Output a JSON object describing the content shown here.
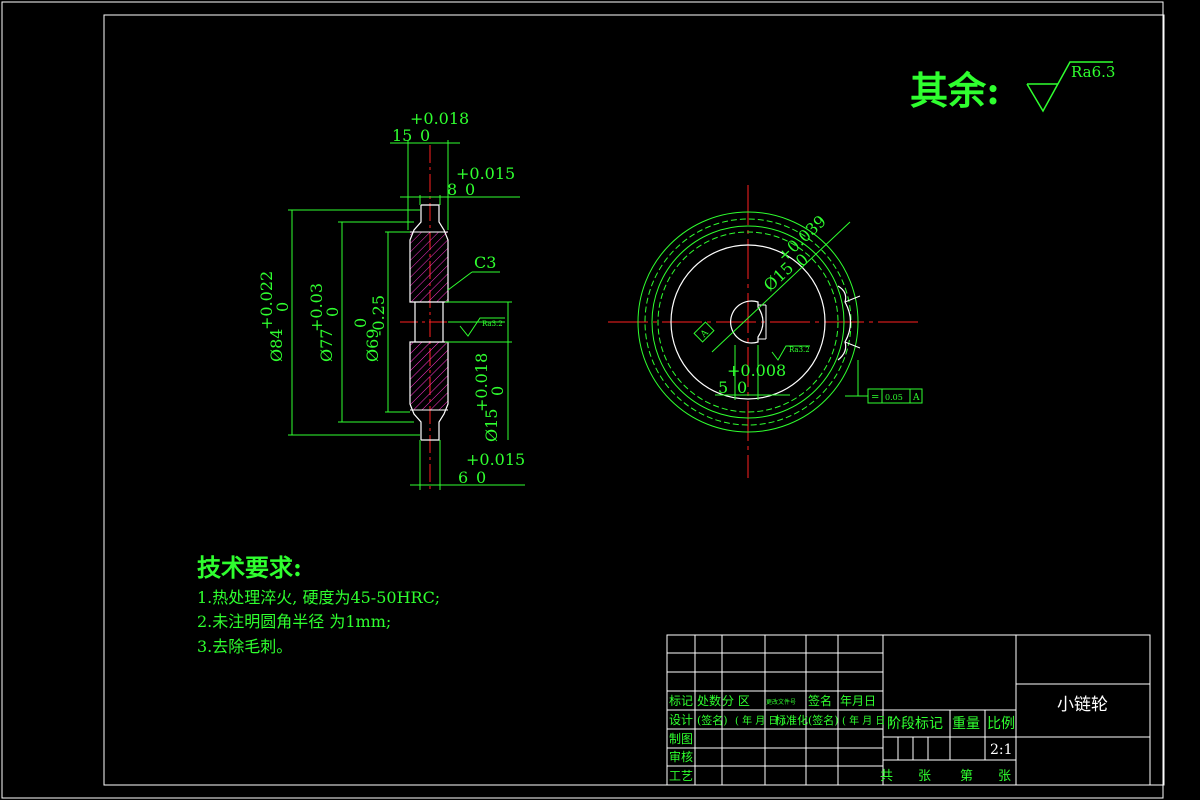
{
  "title_block": {
    "part_name": "小链轮",
    "scale": "2:1",
    "headers": {
      "biaoji": "标记",
      "chushu": "处数",
      "fenqu": "分 区",
      "wenjian": "更改文件号",
      "qianming": "签名",
      "nianyueri": "年月日",
      "sheji": "设计",
      "qianming2": "(签名)",
      "nianyueri2": "( 年 月 日 )",
      "biaozhunhua": "标准化",
      "qianming3": "(签名)",
      "nianyueri3": "( 年 月 日 )",
      "zhitu": "制图",
      "shenhe": "审核",
      "gongyi": "工艺",
      "jieduan": "阶段标记",
      "zhongliang": "重量",
      "bili": "比例",
      "gong": "共",
      "zhang1": "张",
      "di": "第",
      "zhang2": "张"
    }
  },
  "surface_finish_general": {
    "label": "其余:",
    "value": "Ra6.3"
  },
  "tech_requirements": {
    "heading": "技术要求:",
    "items": [
      "1.热处理淬火, 硬度为45-50HRC;",
      "2.未注明圆角半径 为1mm;",
      "3.去除毛刺。"
    ]
  },
  "dimensions": {
    "width_15": {
      "tol": "+0.018",
      "base": "15",
      "low": "0"
    },
    "width_8": {
      "tol": "+0.015",
      "base": "8",
      "low": "0"
    },
    "width_6": {
      "tol": "+0.015",
      "base": "6",
      "low": "0"
    },
    "dia_84": {
      "base": "Ø84",
      "tol": "+0.022",
      "low": "0"
    },
    "dia_77": {
      "base": "Ø77",
      "tol": "+0.03",
      "low": "0"
    },
    "dia_69": {
      "base": "Ø69",
      "tol": "0",
      "low": "-0.25"
    },
    "dia_15_side": {
      "base": "Ø15",
      "tol": "+0.018",
      "low": "0"
    },
    "chamfer": "C3",
    "bore_dia": {
      "base": "Ø15",
      "tol": "+0.039",
      "low": "0"
    },
    "keyway": {
      "tol": "+0.008",
      "base": "5",
      "low": "0"
    },
    "ra_small": "Ra3.2",
    "datum": "A",
    "geo_tol": {
      "symbol": "=",
      "value": "0.05",
      "datum": "A"
    }
  }
}
